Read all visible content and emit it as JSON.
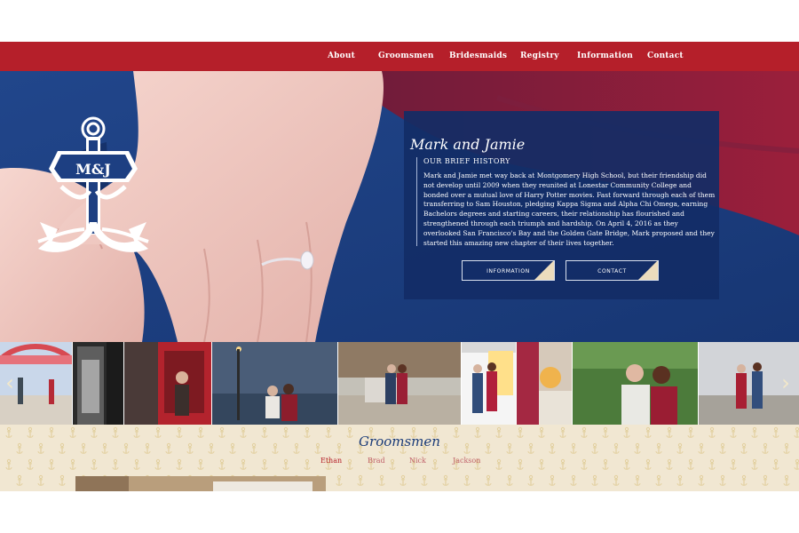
{
  "nav": {
    "items": [
      {
        "label": "About"
      },
      {
        "label": "Groomsmen"
      },
      {
        "label": "Bridesmaids"
      },
      {
        "label": "Registry"
      },
      {
        "label": "Information"
      },
      {
        "label": "Contact"
      }
    ]
  },
  "logo": {
    "monogram": "M&J"
  },
  "story": {
    "title": "Mark and Jamie",
    "subtitle": "OUR BRIEF HISTORY",
    "body": "Mark and Jamie met way back at Montgomery High School, but their friendship did not develop until 2009 when they reunited at Lonestar Community College and bonded over a mutual love of Harry Potter movies. Fast forward through each of them transferring to Sam Houston, pledging Kappa Sigma and Alpha Chi Omega, earning Bachelors degrees and starting careers, their relationship has flourished and strengthened through each triumph and hardship. On April 4, 2016 as they overlooked San Francisco's Bay and the Golden Gate Bridge, Mark proposed and they started this amazing new chapter of their lives together.",
    "buttons": [
      {
        "label": "INFORMATION"
      },
      {
        "label": "CONTACT"
      }
    ]
  },
  "strip": {
    "prev_icon": "chevron-left-icon",
    "next_icon": "chevron-right-icon",
    "arrow_prev": "‹",
    "arrow_next": "›"
  },
  "groomsmen": {
    "title": "Groomsmen",
    "names": [
      {
        "label": "Ethan",
        "active": true
      },
      {
        "label": "Brad",
        "active": false
      },
      {
        "label": "Nick",
        "active": false
      },
      {
        "label": "Jackson",
        "active": false
      }
    ]
  },
  "colors": {
    "nav_red": "#b51f2a",
    "navy": "#1a3b78",
    "cream": "#f1e7d2"
  }
}
